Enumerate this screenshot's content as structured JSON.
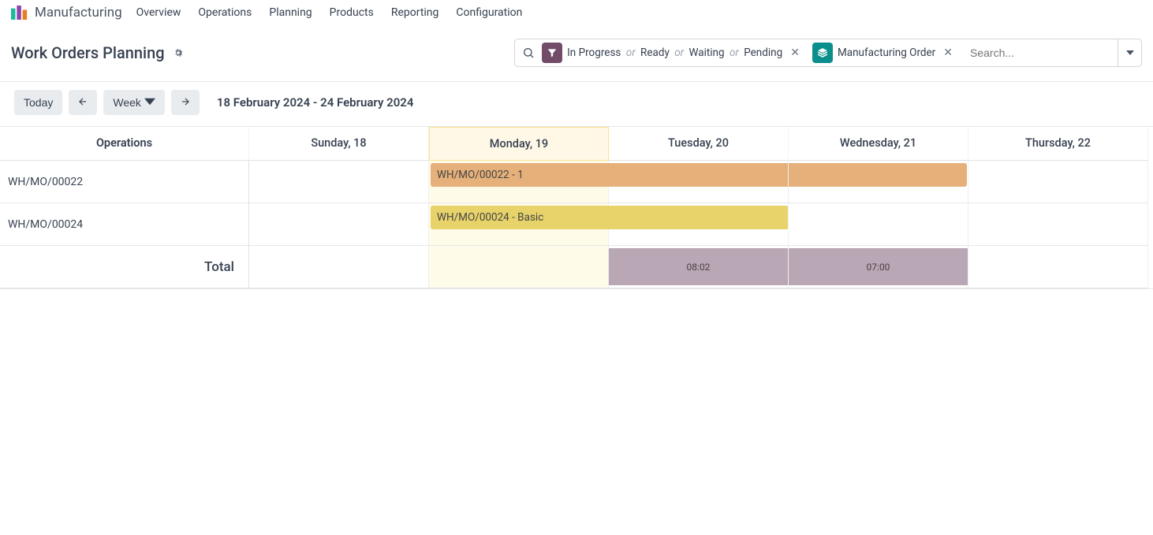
{
  "nav": {
    "app": "Manufacturing",
    "links": [
      "Overview",
      "Operations",
      "Planning",
      "Products",
      "Reporting",
      "Configuration"
    ]
  },
  "page": {
    "title": "Work Orders Planning"
  },
  "search": {
    "placeholder": "Search...",
    "filter_chip": {
      "parts": [
        "In Progress",
        "Ready",
        "Waiting",
        "Pending"
      ]
    },
    "group_chip": {
      "label": "Manufacturing Order"
    }
  },
  "toolbar": {
    "today": "Today",
    "scale": "Week",
    "date_range": "18 February 2024 - 24 February 2024"
  },
  "gantt": {
    "side_header": "Operations",
    "columns": [
      "Sunday, 18",
      "Monday, 19",
      "Tuesday, 20",
      "Wednesday, 21",
      "Thursday, 22"
    ],
    "today_index": 1,
    "rows": [
      {
        "label": "WH/MO/00022",
        "bar_label": "WH/MO/00022 - 1"
      },
      {
        "label": "WH/MO/00024",
        "bar_label": "WH/MO/00024 - Basic"
      }
    ],
    "total_label": "Total",
    "totals": {
      "tue": "08:02",
      "wed": "07:00"
    }
  }
}
